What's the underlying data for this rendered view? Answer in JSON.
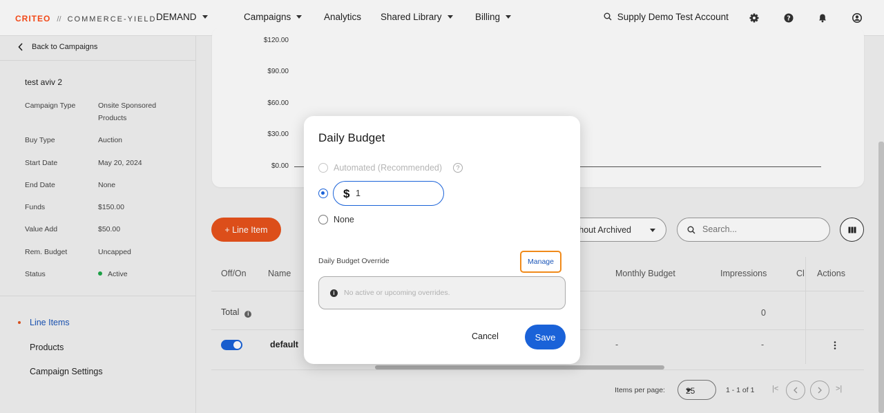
{
  "topnav": {
    "logo_brand": "CRITEO",
    "logo_separator": "//",
    "logo_product": "COMMERCE-YIELD",
    "demand": "DEMAND",
    "campaigns": "Campaigns",
    "analytics": "Analytics",
    "shared_library": "Shared Library",
    "billing": "Billing",
    "account": "Supply Demo Test Account",
    "icons": [
      "search-icon",
      "gear-icon",
      "help-icon",
      "bell-icon",
      "user-icon"
    ]
  },
  "sidebar": {
    "back": "Back to Campaigns",
    "campaign_name": "test aviv 2",
    "info": [
      {
        "label": "Campaign Type",
        "value": "Onsite Sponsored Products"
      },
      {
        "label": "Buy Type",
        "value": "Auction"
      },
      {
        "label": "Start Date",
        "value": "May 20, 2024"
      },
      {
        "label": "End Date",
        "value": "None"
      },
      {
        "label": "Funds",
        "value": "$150.00"
      },
      {
        "label": "Value Add",
        "value": "$50.00"
      },
      {
        "label": "Rem. Budget",
        "value": "Uncapped"
      },
      {
        "label": "Status",
        "value": "Active"
      }
    ],
    "nav": [
      "Line Items",
      "Products",
      "Campaign Settings"
    ],
    "active_nav": "Line Items"
  },
  "chart": {
    "y_ticks": [
      "$120.00",
      "$90.00",
      "$60.00",
      "$30.00",
      "$0.00"
    ]
  },
  "toolbar": {
    "add_button": "+ Line Item",
    "filter_value": "Without Archived",
    "search_placeholder": "Search..."
  },
  "table": {
    "headers": [
      "Off/On",
      "Name",
      "Monthly Budget",
      "Impressions",
      "Cl",
      "Actions"
    ],
    "total_label": "Total",
    "total_impressions": "0",
    "rows": [
      {
        "name": "default",
        "monthly_budget": "-",
        "impressions": "-"
      }
    ]
  },
  "pagination": {
    "items_per_page_label": "Items per page:",
    "items_per_page": "25",
    "range": "1 - 1 of 1"
  },
  "dialog": {
    "title": "Daily Budget",
    "option_automated": "Automated (Recommended)",
    "currency_symbol": "$",
    "budget_value": "1",
    "option_none": "None",
    "override_label": "Daily Budget Override",
    "manage_button": "Manage",
    "override_message": "No active or upcoming overrides.",
    "cancel_button": "Cancel",
    "save_button": "Save"
  },
  "colors": {
    "brand_orange": "#e8531c",
    "primary_blue": "#1a62d8",
    "highlight_orange": "#f08a1a",
    "status_green": "#1fa84a"
  }
}
